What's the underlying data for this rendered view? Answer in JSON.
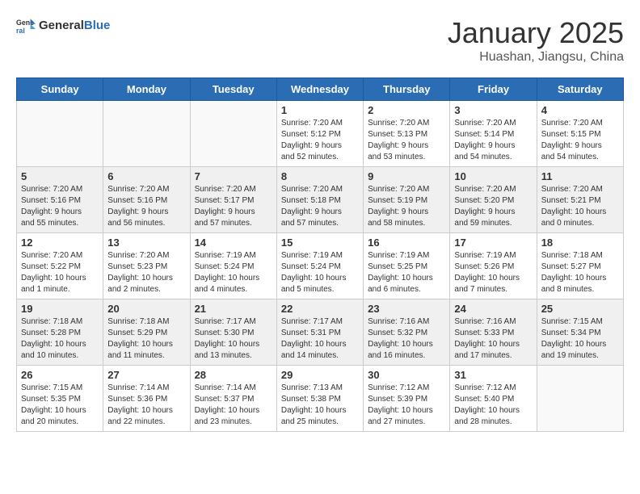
{
  "header": {
    "logo_general": "General",
    "logo_blue": "Blue",
    "title": "January 2025",
    "subtitle": "Huashan, Jiangsu, China"
  },
  "weekdays": [
    "Sunday",
    "Monday",
    "Tuesday",
    "Wednesday",
    "Thursday",
    "Friday",
    "Saturday"
  ],
  "weeks": [
    [
      {
        "day": "",
        "info": ""
      },
      {
        "day": "",
        "info": ""
      },
      {
        "day": "",
        "info": ""
      },
      {
        "day": "1",
        "info": "Sunrise: 7:20 AM\nSunset: 5:12 PM\nDaylight: 9 hours\nand 52 minutes."
      },
      {
        "day": "2",
        "info": "Sunrise: 7:20 AM\nSunset: 5:13 PM\nDaylight: 9 hours\nand 53 minutes."
      },
      {
        "day": "3",
        "info": "Sunrise: 7:20 AM\nSunset: 5:14 PM\nDaylight: 9 hours\nand 54 minutes."
      },
      {
        "day": "4",
        "info": "Sunrise: 7:20 AM\nSunset: 5:15 PM\nDaylight: 9 hours\nand 54 minutes."
      }
    ],
    [
      {
        "day": "5",
        "info": "Sunrise: 7:20 AM\nSunset: 5:16 PM\nDaylight: 9 hours\nand 55 minutes."
      },
      {
        "day": "6",
        "info": "Sunrise: 7:20 AM\nSunset: 5:16 PM\nDaylight: 9 hours\nand 56 minutes."
      },
      {
        "day": "7",
        "info": "Sunrise: 7:20 AM\nSunset: 5:17 PM\nDaylight: 9 hours\nand 57 minutes."
      },
      {
        "day": "8",
        "info": "Sunrise: 7:20 AM\nSunset: 5:18 PM\nDaylight: 9 hours\nand 57 minutes."
      },
      {
        "day": "9",
        "info": "Sunrise: 7:20 AM\nSunset: 5:19 PM\nDaylight: 9 hours\nand 58 minutes."
      },
      {
        "day": "10",
        "info": "Sunrise: 7:20 AM\nSunset: 5:20 PM\nDaylight: 9 hours\nand 59 minutes."
      },
      {
        "day": "11",
        "info": "Sunrise: 7:20 AM\nSunset: 5:21 PM\nDaylight: 10 hours\nand 0 minutes."
      }
    ],
    [
      {
        "day": "12",
        "info": "Sunrise: 7:20 AM\nSunset: 5:22 PM\nDaylight: 10 hours\nand 1 minute."
      },
      {
        "day": "13",
        "info": "Sunrise: 7:20 AM\nSunset: 5:23 PM\nDaylight: 10 hours\nand 2 minutes."
      },
      {
        "day": "14",
        "info": "Sunrise: 7:19 AM\nSunset: 5:24 PM\nDaylight: 10 hours\nand 4 minutes."
      },
      {
        "day": "15",
        "info": "Sunrise: 7:19 AM\nSunset: 5:24 PM\nDaylight: 10 hours\nand 5 minutes."
      },
      {
        "day": "16",
        "info": "Sunrise: 7:19 AM\nSunset: 5:25 PM\nDaylight: 10 hours\nand 6 minutes."
      },
      {
        "day": "17",
        "info": "Sunrise: 7:19 AM\nSunset: 5:26 PM\nDaylight: 10 hours\nand 7 minutes."
      },
      {
        "day": "18",
        "info": "Sunrise: 7:18 AM\nSunset: 5:27 PM\nDaylight: 10 hours\nand 8 minutes."
      }
    ],
    [
      {
        "day": "19",
        "info": "Sunrise: 7:18 AM\nSunset: 5:28 PM\nDaylight: 10 hours\nand 10 minutes."
      },
      {
        "day": "20",
        "info": "Sunrise: 7:18 AM\nSunset: 5:29 PM\nDaylight: 10 hours\nand 11 minutes."
      },
      {
        "day": "21",
        "info": "Sunrise: 7:17 AM\nSunset: 5:30 PM\nDaylight: 10 hours\nand 13 minutes."
      },
      {
        "day": "22",
        "info": "Sunrise: 7:17 AM\nSunset: 5:31 PM\nDaylight: 10 hours\nand 14 minutes."
      },
      {
        "day": "23",
        "info": "Sunrise: 7:16 AM\nSunset: 5:32 PM\nDaylight: 10 hours\nand 16 minutes."
      },
      {
        "day": "24",
        "info": "Sunrise: 7:16 AM\nSunset: 5:33 PM\nDaylight: 10 hours\nand 17 minutes."
      },
      {
        "day": "25",
        "info": "Sunrise: 7:15 AM\nSunset: 5:34 PM\nDaylight: 10 hours\nand 19 minutes."
      }
    ],
    [
      {
        "day": "26",
        "info": "Sunrise: 7:15 AM\nSunset: 5:35 PM\nDaylight: 10 hours\nand 20 minutes."
      },
      {
        "day": "27",
        "info": "Sunrise: 7:14 AM\nSunset: 5:36 PM\nDaylight: 10 hours\nand 22 minutes."
      },
      {
        "day": "28",
        "info": "Sunrise: 7:14 AM\nSunset: 5:37 PM\nDaylight: 10 hours\nand 23 minutes."
      },
      {
        "day": "29",
        "info": "Sunrise: 7:13 AM\nSunset: 5:38 PM\nDaylight: 10 hours\nand 25 minutes."
      },
      {
        "day": "30",
        "info": "Sunrise: 7:12 AM\nSunset: 5:39 PM\nDaylight: 10 hours\nand 27 minutes."
      },
      {
        "day": "31",
        "info": "Sunrise: 7:12 AM\nSunset: 5:40 PM\nDaylight: 10 hours\nand 28 minutes."
      },
      {
        "day": "",
        "info": ""
      }
    ]
  ]
}
